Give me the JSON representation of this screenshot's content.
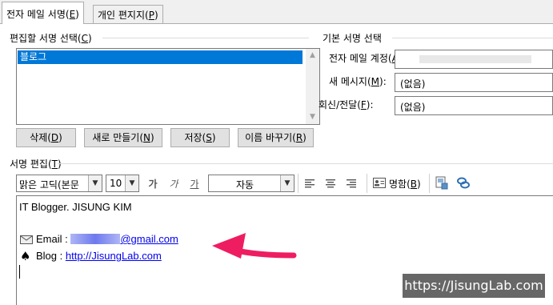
{
  "tabs": [
    {
      "label": "전자 메일 서명(",
      "key": "E",
      "suffix": ")"
    },
    {
      "label": "개인 편지지(",
      "key": "P",
      "suffix": ")"
    }
  ],
  "select_signature": {
    "label": "편집할 서명 선택(",
    "key": "C",
    "suffix": ")",
    "items": [
      "블로그"
    ],
    "selected_index": 0
  },
  "buttons": {
    "delete": {
      "label": "삭제(",
      "key": "D",
      "suffix": ")"
    },
    "new": {
      "label": "새로 만들기(",
      "key": "N",
      "suffix": ")"
    },
    "save": {
      "label": "저장(",
      "key": "S",
      "suffix": ")"
    },
    "rename": {
      "label": "이름 바꾸기(",
      "key": "R",
      "suffix": ")"
    }
  },
  "default_signature": {
    "title": "기본 서명 선택",
    "account": {
      "label": "전자 메일 계정(",
      "key": "A",
      "suffix": "):",
      "value": ""
    },
    "new_messages": {
      "label": "새 메시지(",
      "key": "M",
      "suffix": "):",
      "value": "(없음)"
    },
    "replies": {
      "label": "회신/전달(",
      "key": "F",
      "suffix": "):",
      "value": "(없음)"
    }
  },
  "edit_signature": {
    "label": "서명 편집(",
    "key": "T",
    "suffix": ")",
    "toolbar": {
      "font": "맑은 고딕(본문 ",
      "size": "10",
      "bold": "가",
      "italic": "가",
      "underline": "가",
      "color": "자동",
      "business_card": "명함(",
      "business_card_key": "B",
      "business_card_suffix": ")"
    },
    "content": {
      "line1": "IT Blogger. JISUNG KIM",
      "email_prefix": "Email : ",
      "email_domain": "@gmail.com",
      "blog_prefix": "Blog : ",
      "blog_link": "http://JisungLab.com"
    }
  },
  "watermark": "https://JisungLab.com",
  "colors": {
    "selection": "#0078d7",
    "arrow": "#ee1d62",
    "link": "#0000ee"
  }
}
